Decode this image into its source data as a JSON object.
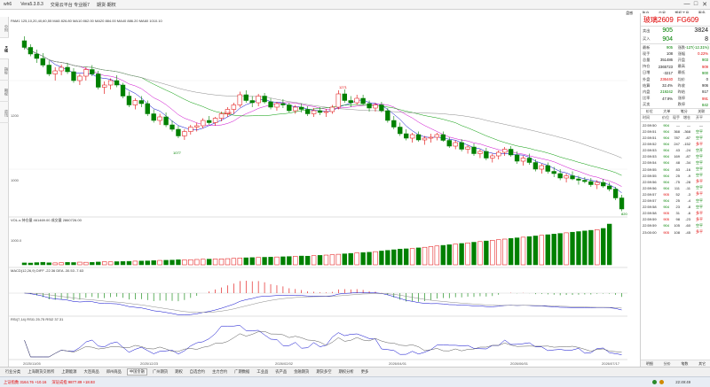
{
  "window": {
    "title": "wh6",
    "menus": [
      "Vera5.3.8.3",
      "交易云平台 专业版7",
      "期货·期权"
    ],
    "controls": [
      "—",
      "□",
      "✕"
    ]
  },
  "toolbar": [
    "盘感",
    "账户",
    "交易",
    "期权工具",
    "更多"
  ],
  "left_tabs": [
    "分时",
    "K线",
    "指标",
    "期权",
    "资讯"
  ],
  "chart": {
    "header": "PAM1 125,10,20,40,60,55 MA5 826.80 MA10 862.00 MA20 884.00 MA40 886.20 MA60 1010.10",
    "y_labels": [
      "1200",
      "1000"
    ],
    "annotations": [
      "1285",
      "1077",
      "1271",
      "1268",
      "820"
    ],
    "volume_header": "VOL-s 持仓量 461469.00 成交量 2860726.00",
    "volume_y": "1000.0",
    "macd_header": "MACD(12,26,9) DIFF -22.36 DEA -30.53 -7.63",
    "rsi_header": "RSI(7,14) RSI1 25.75 RSI2 37.31",
    "x_labels": [
      "2025/11/05",
      "2025/12/23",
      "2026/02/02",
      "2026/04/01",
      "2026/06/01",
      "2026/07/17"
    ],
    "colors": {
      "up": "#e00000",
      "down": "#008000",
      "ma1": "#0000cc",
      "ma2": "#cc00cc",
      "ma3": "#009900",
      "ma4": "#888888"
    }
  },
  "chart_data": {
    "type": "candlestick",
    "ohlc": [
      [
        1290,
        1300,
        1270,
        1275
      ],
      [
        1275,
        1282,
        1255,
        1260
      ],
      [
        1260,
        1270,
        1240,
        1250
      ],
      [
        1250,
        1262,
        1230,
        1235
      ],
      [
        1235,
        1245,
        1210,
        1215
      ],
      [
        1215,
        1230,
        1200,
        1222
      ],
      [
        1222,
        1236,
        1212,
        1230
      ],
      [
        1230,
        1240,
        1215,
        1220
      ],
      [
        1220,
        1228,
        1195,
        1200
      ],
      [
        1200,
        1215,
        1190,
        1210
      ],
      [
        1210,
        1230,
        1200,
        1225
      ],
      [
        1225,
        1235,
        1210,
        1215
      ],
      [
        1215,
        1222,
        1180,
        1185
      ],
      [
        1185,
        1198,
        1170,
        1190
      ],
      [
        1190,
        1205,
        1180,
        1200
      ],
      [
        1200,
        1212,
        1185,
        1190
      ],
      [
        1190,
        1195,
        1160,
        1165
      ],
      [
        1165,
        1175,
        1140,
        1145
      ],
      [
        1145,
        1160,
        1135,
        1155
      ],
      [
        1155,
        1165,
        1140,
        1148
      ],
      [
        1148,
        1155,
        1120,
        1125
      ],
      [
        1125,
        1135,
        1105,
        1110
      ],
      [
        1110,
        1125,
        1100,
        1118
      ],
      [
        1118,
        1128,
        1095,
        1100
      ],
      [
        1100,
        1110,
        1085,
        1090
      ],
      [
        1090,
        1098,
        1070,
        1075
      ],
      [
        1075,
        1090,
        1066,
        1085
      ],
      [
        1085,
        1100,
        1078,
        1095
      ],
      [
        1095,
        1105,
        1085,
        1098
      ],
      [
        1098,
        1115,
        1092,
        1110
      ],
      [
        1110,
        1120,
        1100,
        1105
      ],
      [
        1105,
        1118,
        1098,
        1115
      ],
      [
        1115,
        1130,
        1108,
        1125
      ],
      [
        1125,
        1140,
        1118,
        1135
      ],
      [
        1135,
        1150,
        1125,
        1145
      ],
      [
        1145,
        1175,
        1140,
        1168
      ],
      [
        1168,
        1178,
        1150,
        1155
      ],
      [
        1155,
        1165,
        1140,
        1150
      ],
      [
        1150,
        1170,
        1142,
        1165
      ],
      [
        1165,
        1172,
        1148,
        1152
      ],
      [
        1152,
        1160,
        1135,
        1140
      ],
      [
        1140,
        1152,
        1132,
        1148
      ],
      [
        1148,
        1158,
        1138,
        1145
      ],
      [
        1145,
        1150,
        1128,
        1132
      ],
      [
        1132,
        1145,
        1125,
        1140
      ],
      [
        1140,
        1148,
        1128,
        1135
      ],
      [
        1135,
        1142,
        1120,
        1125
      ],
      [
        1125,
        1138,
        1118,
        1132
      ],
      [
        1132,
        1140,
        1122,
        1128
      ],
      [
        1128,
        1136,
        1118,
        1130
      ],
      [
        1130,
        1145,
        1125,
        1140
      ],
      [
        1140,
        1178,
        1135,
        1170
      ],
      [
        1170,
        1180,
        1150,
        1155
      ],
      [
        1155,
        1165,
        1140,
        1150
      ],
      [
        1150,
        1168,
        1145,
        1160
      ],
      [
        1160,
        1168,
        1145,
        1148
      ],
      [
        1148,
        1155,
        1130,
        1138
      ],
      [
        1138,
        1150,
        1130,
        1145
      ],
      [
        1145,
        1152,
        1128,
        1132
      ],
      [
        1132,
        1138,
        1105,
        1110
      ],
      [
        1110,
        1120,
        1090,
        1095
      ],
      [
        1095,
        1105,
        1075,
        1080
      ],
      [
        1080,
        1090,
        1065,
        1070
      ],
      [
        1070,
        1082,
        1060,
        1078
      ],
      [
        1078,
        1085,
        1062,
        1066
      ],
      [
        1066,
        1075,
        1055,
        1070
      ],
      [
        1070,
        1080,
        1060,
        1072
      ],
      [
        1072,
        1082,
        1065,
        1078
      ],
      [
        1078,
        1085,
        1062,
        1065
      ],
      [
        1065,
        1072,
        1048,
        1052
      ],
      [
        1052,
        1065,
        1045,
        1060
      ],
      [
        1060,
        1068,
        1040,
        1045
      ],
      [
        1045,
        1055,
        1035,
        1050
      ],
      [
        1050,
        1058,
        1030,
        1035
      ],
      [
        1035,
        1045,
        1025,
        1040
      ],
      [
        1040,
        1048,
        1020,
        1025
      ],
      [
        1025,
        1035,
        1015,
        1030
      ],
      [
        1030,
        1042,
        1022,
        1038
      ],
      [
        1038,
        1050,
        1030,
        1045
      ],
      [
        1045,
        1052,
        1028,
        1032
      ],
      [
        1032,
        1040,
        1012,
        1018
      ],
      [
        1018,
        1030,
        1008,
        1025
      ],
      [
        1025,
        1035,
        1010,
        1015
      ],
      [
        1015,
        1022,
        995,
        1000
      ],
      [
        1000,
        1012,
        990,
        1008
      ],
      [
        1008,
        1015,
        990,
        995
      ],
      [
        995,
        1005,
        982,
        990
      ],
      [
        990,
        1000,
        975,
        980
      ],
      [
        980,
        990,
        970,
        985
      ],
      [
        985,
        995,
        975,
        978
      ],
      [
        978,
        985,
        965,
        975
      ],
      [
        975,
        982,
        968,
        972
      ],
      [
        972,
        980,
        960,
        965
      ],
      [
        965,
        975,
        955,
        970
      ],
      [
        970,
        978,
        958,
        962
      ],
      [
        962,
        970,
        950,
        955
      ],
      [
        955,
        960,
        930,
        935
      ],
      [
        935,
        942,
        905,
        910
      ]
    ],
    "volume": [
      30,
      28,
      35,
      40,
      32,
      30,
      34,
      38,
      36,
      42,
      40,
      38,
      44,
      48,
      46,
      50,
      52,
      55,
      58,
      60,
      62,
      66,
      70,
      72,
      75,
      80,
      78,
      82,
      85,
      88,
      90,
      92,
      95,
      98,
      102,
      108,
      112,
      115,
      118,
      120,
      122,
      125,
      128,
      132,
      135,
      140,
      138,
      145,
      150,
      155,
      160,
      168,
      175,
      182,
      190,
      195,
      200,
      210,
      220,
      230,
      240,
      250,
      255,
      260,
      270,
      280,
      290,
      300,
      310,
      320,
      330,
      340,
      350,
      360,
      370,
      380,
      390,
      400,
      410,
      420,
      430,
      440,
      450,
      460,
      470,
      480,
      490,
      500,
      510,
      520,
      530,
      540,
      550,
      560,
      580,
      650
    ],
    "ylim": [
      900,
      1320
    ],
    "xlabel": "",
    "ylabel": ""
  },
  "quote": {
    "name": "玻璃2609",
    "code": "FG609",
    "bid_label": "卖出",
    "bid_price": "905",
    "bid_vol": "3824",
    "ask_label": "买入",
    "ask_price": "904",
    "ask_vol": "8",
    "rows": [
      {
        "k1": "最新",
        "v1": "905",
        "k2": "涨跌",
        "v2": "-127(-12.31%)",
        "c1": "green",
        "c2": "green"
      },
      {
        "k1": "现手",
        "v1": "108",
        "k2": "涨幅",
        "v2": "0.22%",
        "c1": "blk",
        "c2": "red"
      },
      {
        "k1": "总量",
        "v1": "351486",
        "k2": "开盘",
        "v2": "903",
        "c1": "blk",
        "c2": "green"
      },
      {
        "k1": "持仓",
        "v1": "2365723",
        "k2": "最高",
        "v2": "909",
        "c1": "blk",
        "c2": "red"
      },
      {
        "k1": "日增",
        "v1": "-3217",
        "k2": "最低",
        "v2": "900",
        "c1": "blk",
        "c2": "green"
      },
      {
        "k1": "外盘",
        "v1": "236440",
        "k2": "均价",
        "v2": "0",
        "c1": "red",
        "c2": "blk"
      },
      {
        "k1": "结算",
        "v1": "32.4%",
        "k2": "昨收",
        "v2": "906",
        "c1": "blk",
        "c2": "blk"
      },
      {
        "k1": "内盘",
        "v1": "219242",
        "k2": "昨结",
        "v2": "917",
        "c1": "green",
        "c2": "blk"
      },
      {
        "k1": "比率",
        "v1": "47.9%",
        "k2": "涨停",
        "v2": "991",
        "c1": "blk",
        "c2": "red"
      },
      {
        "k1": "买卖",
        "v1": "",
        "k2": "跌停",
        "v2": "842",
        "c1": "blk",
        "c2": "green"
      }
    ],
    "buttons": [
      "价位",
      "大单",
      "笔分",
      "关联"
    ],
    "tick_headers": [
      "时间",
      "价位",
      "现手",
      "增仓",
      "开平"
    ],
    "ticks": [
      {
        "t": "22:59:50",
        "p": "904",
        "v": "—",
        "d": "—",
        "k": "—",
        "pc": "green",
        "kc": "blk"
      },
      {
        "t": "22:59:51",
        "p": "904",
        "v": "368",
        "d": "-368",
        "k": "空平",
        "pc": "green",
        "kc": "green"
      },
      {
        "t": "22:59:51",
        "p": "904",
        "v": "787",
        "d": "-87",
        "k": "空平",
        "pc": "green",
        "kc": "green"
      },
      {
        "t": "22:59:52",
        "p": "904",
        "v": "247",
        "d": "-152",
        "k": "多平",
        "pc": "green",
        "kc": "red"
      },
      {
        "t": "22:59:53",
        "p": "904",
        "v": "43",
        "d": "-24",
        "k": "空开",
        "pc": "green",
        "kc": "green"
      },
      {
        "t": "22:59:53",
        "p": "904",
        "v": "169",
        "d": "-87",
        "k": "空平",
        "pc": "green",
        "kc": "green"
      },
      {
        "t": "22:59:54",
        "p": "904",
        "v": "48",
        "d": "-34",
        "k": "空平",
        "pc": "green",
        "kc": "green"
      },
      {
        "t": "22:59:55",
        "p": "904",
        "v": "83",
        "d": "-16",
        "k": "空平",
        "pc": "green",
        "kc": "green"
      },
      {
        "t": "22:59:55",
        "p": "904",
        "v": "25",
        "d": "-9",
        "k": "空平",
        "pc": "green",
        "kc": "green"
      },
      {
        "t": "22:59:56",
        "p": "904",
        "v": "-75",
        "d": "-28",
        "k": "多平",
        "pc": "green",
        "kc": "red"
      },
      {
        "t": "22:59:56",
        "p": "904",
        "v": "111",
        "d": "-11",
        "k": "空平",
        "pc": "green",
        "kc": "green"
      },
      {
        "t": "22:59:57",
        "p": "905",
        "v": "52",
        "d": "-3",
        "k": "多平",
        "pc": "red",
        "kc": "red"
      },
      {
        "t": "22:59:57",
        "p": "904",
        "v": "25",
        "d": "-4",
        "k": "空平",
        "pc": "green",
        "kc": "green"
      },
      {
        "t": "22:59:58",
        "p": "904",
        "v": "23",
        "d": "-8",
        "k": "空平",
        "pc": "green",
        "kc": "green"
      },
      {
        "t": "22:59:58",
        "p": "905",
        "v": "31",
        "d": "-6",
        "k": "多平",
        "pc": "red",
        "kc": "red"
      },
      {
        "t": "22:59:59",
        "p": "905",
        "v": "98",
        "d": "-23",
        "k": "多平",
        "pc": "red",
        "kc": "red"
      },
      {
        "t": "22:59:59",
        "p": "904",
        "v": "105",
        "d": "-60",
        "k": "空平",
        "pc": "green",
        "kc": "green"
      },
      {
        "t": "23:00:00",
        "p": "905",
        "v": "108",
        "d": "-45",
        "k": "多平",
        "pc": "red",
        "kc": "red"
      }
    ],
    "footer": [
      "明细",
      "分价",
      "笔数",
      "其它"
    ]
  },
  "bottom_tabs": [
    "行业分类",
    "上海期货交易所",
    "上期能源",
    "大连商品",
    "郑州商品",
    "中国金融",
    "广州期货",
    "期权",
    "自选合约",
    "主力合约",
    "广期数据",
    "工业品",
    "农产品",
    "金融期货",
    "期货多空",
    "期权分析",
    "更多"
  ],
  "status": {
    "items": [
      "上证指数 3164.76 +10.16",
      "深证成指 9877.89 +18.93"
    ],
    "time": "22:49:49"
  }
}
